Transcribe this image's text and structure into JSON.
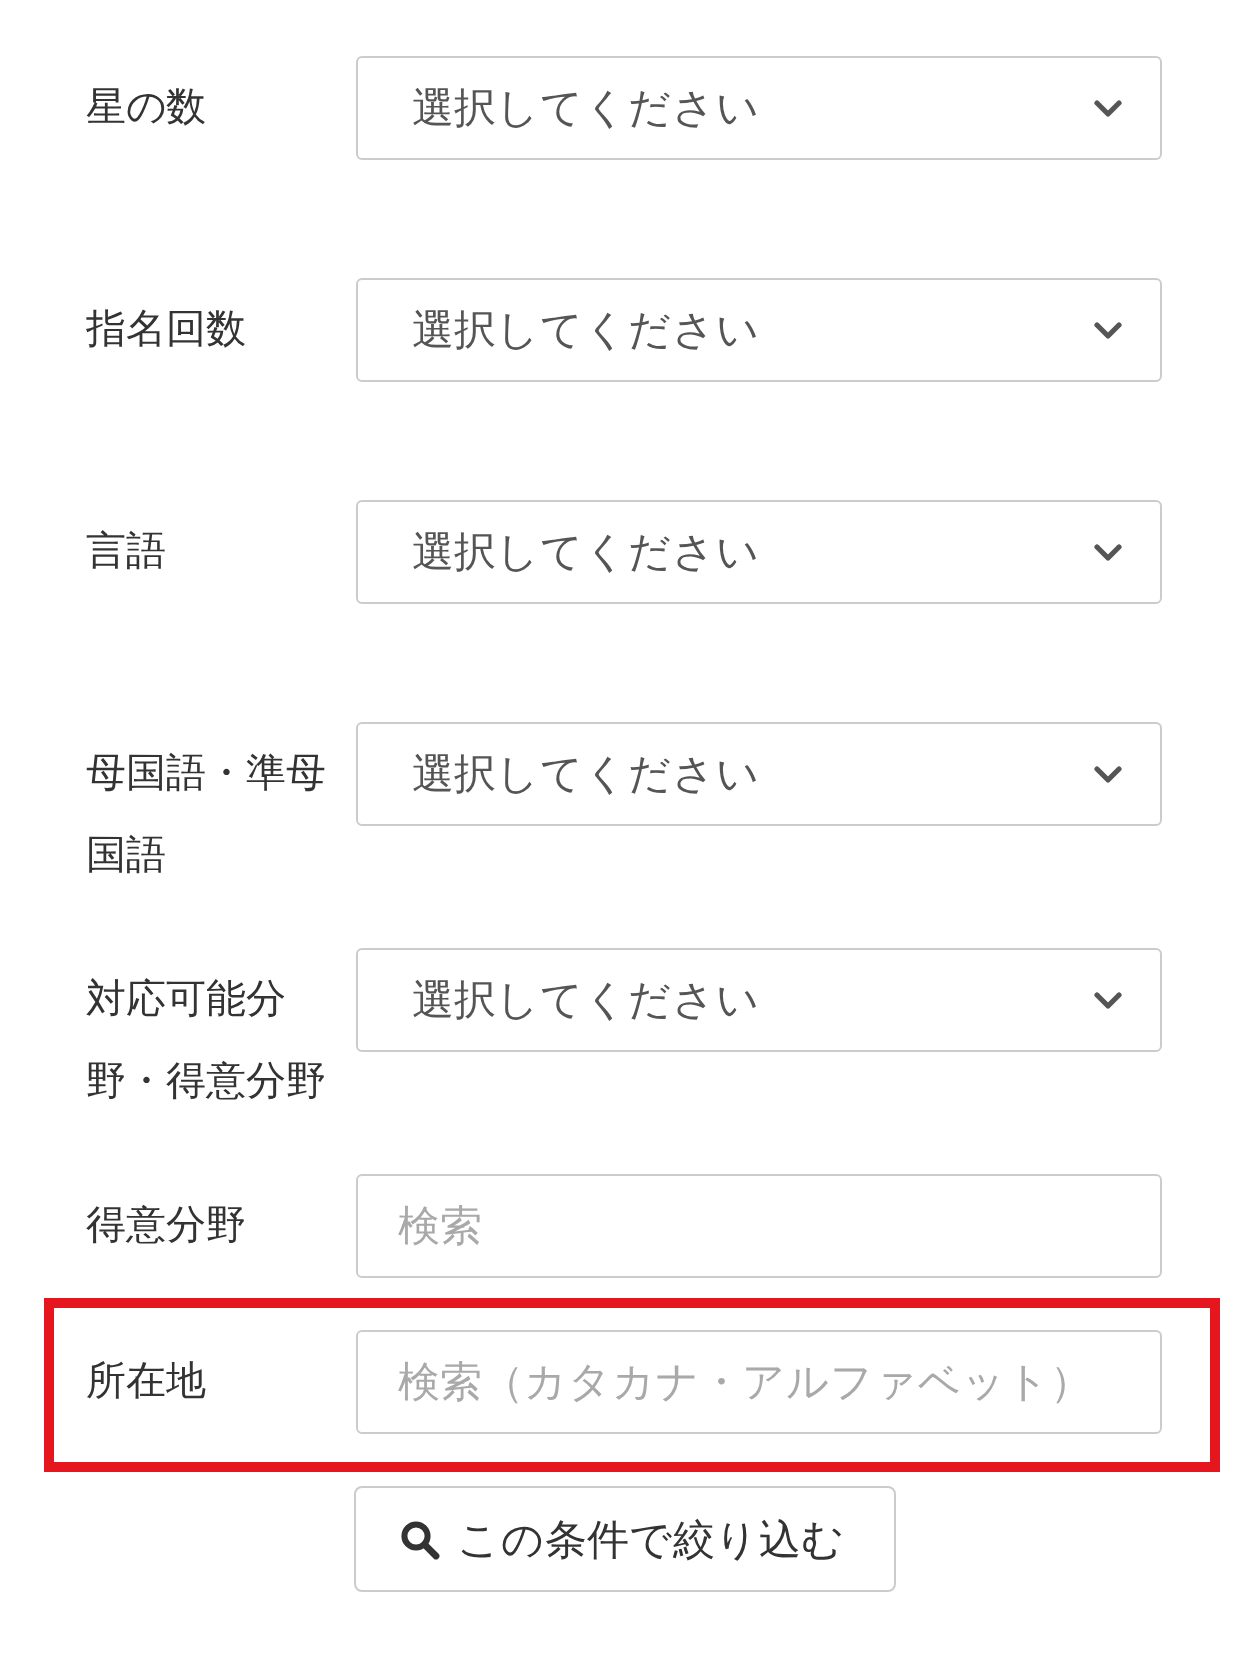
{
  "filters": [
    {
      "kind": "select",
      "label": "星の数",
      "value": "選択してください",
      "highlighted": false
    },
    {
      "kind": "select",
      "label": "指名回数",
      "value": "選択してください",
      "highlighted": false
    },
    {
      "kind": "select",
      "label": "言語",
      "value": "選択してください",
      "highlighted": false
    },
    {
      "kind": "select",
      "label": "母国語・準母国語",
      "value": "選択してください",
      "highlighted": false
    },
    {
      "kind": "select",
      "label": "対応可能分野・得意分野",
      "value": "選択してください",
      "highlighted": false
    },
    {
      "kind": "text",
      "label": "得意分野",
      "placeholder": "検索",
      "highlighted": false
    },
    {
      "kind": "text",
      "label": "所在地",
      "placeholder": "検索（カタカナ・アルファベット）",
      "highlighted": true
    }
  ],
  "submit_button": {
    "label": "この条件で絞り込む"
  }
}
